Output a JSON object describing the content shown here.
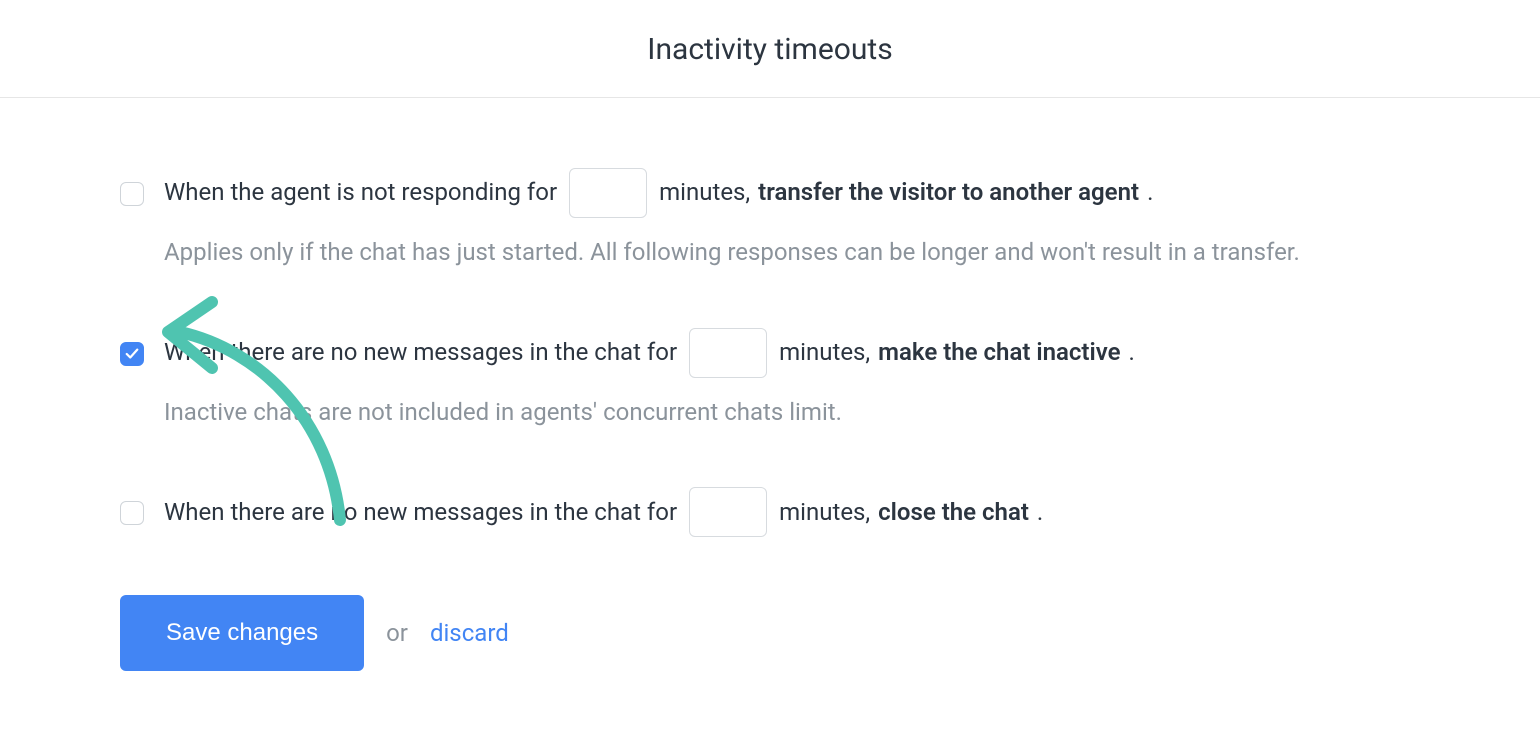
{
  "header": {
    "title": "Inactivity timeouts"
  },
  "options": [
    {
      "pre": "When the agent is not responding for",
      "mid": "minutes,",
      "action": "transfer the visitor to another agent",
      "punct": ".",
      "desc": "Applies only if the chat has just started. All following responses can be longer and won't result in a transfer.",
      "checked": false,
      "value": ""
    },
    {
      "pre": "When there are no new messages in the chat for",
      "mid": "minutes,",
      "action": "make the chat inactive",
      "punct": ".",
      "desc": "Inactive chats are not included in agents' concurrent chats limit.",
      "checked": true,
      "value": ""
    },
    {
      "pre": "When there are no new messages in the chat for",
      "mid": "minutes,",
      "action": "close the chat",
      "punct": ".",
      "desc": "",
      "checked": false,
      "value": ""
    }
  ],
  "actions": {
    "save": "Save changes",
    "or": "or",
    "discard": "discard"
  }
}
